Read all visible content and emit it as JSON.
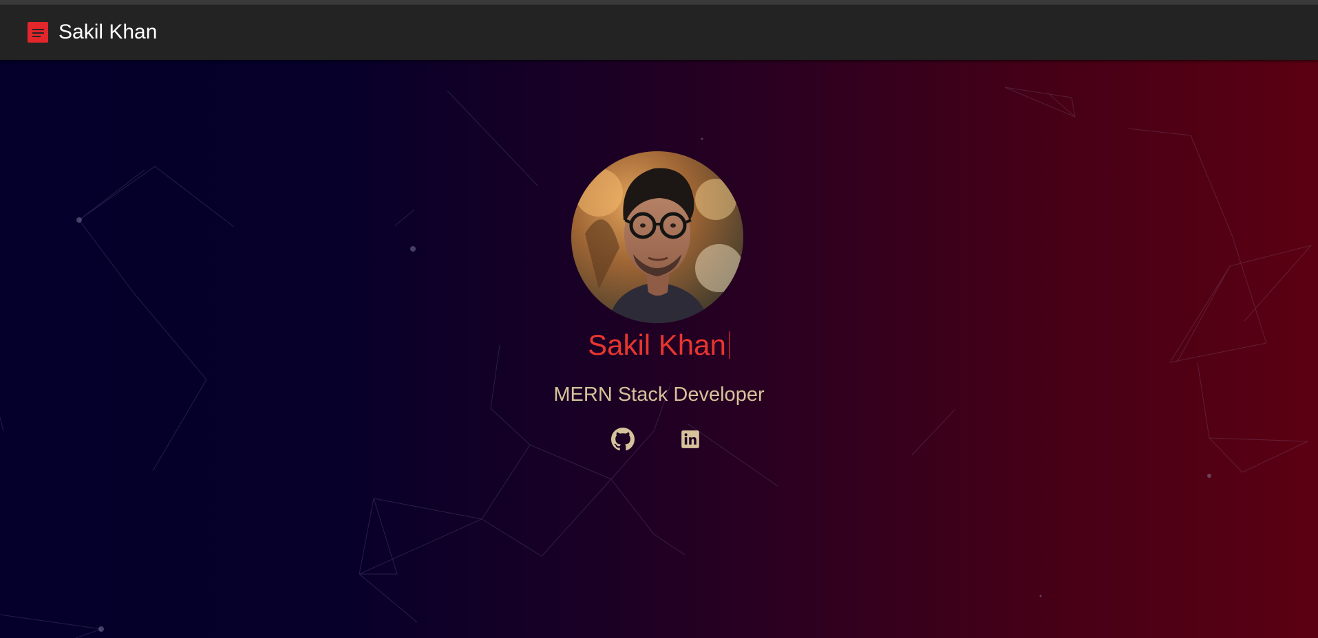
{
  "navbar": {
    "menu_icon": "menu-icon",
    "brand": "Sakil Khan"
  },
  "hero": {
    "name": "Sakil Khan",
    "role": "MERN Stack Developer",
    "avatar_alt": "Profile photo",
    "social": [
      {
        "icon": "github-icon"
      },
      {
        "icon": "linkedin-icon"
      }
    ]
  },
  "colors": {
    "accent": "#e3262c",
    "name": "#e8362f",
    "role": "#d6c29a",
    "navbar": "#232323",
    "gradient_start": "#04002b",
    "gradient_end": "#5b0012"
  }
}
